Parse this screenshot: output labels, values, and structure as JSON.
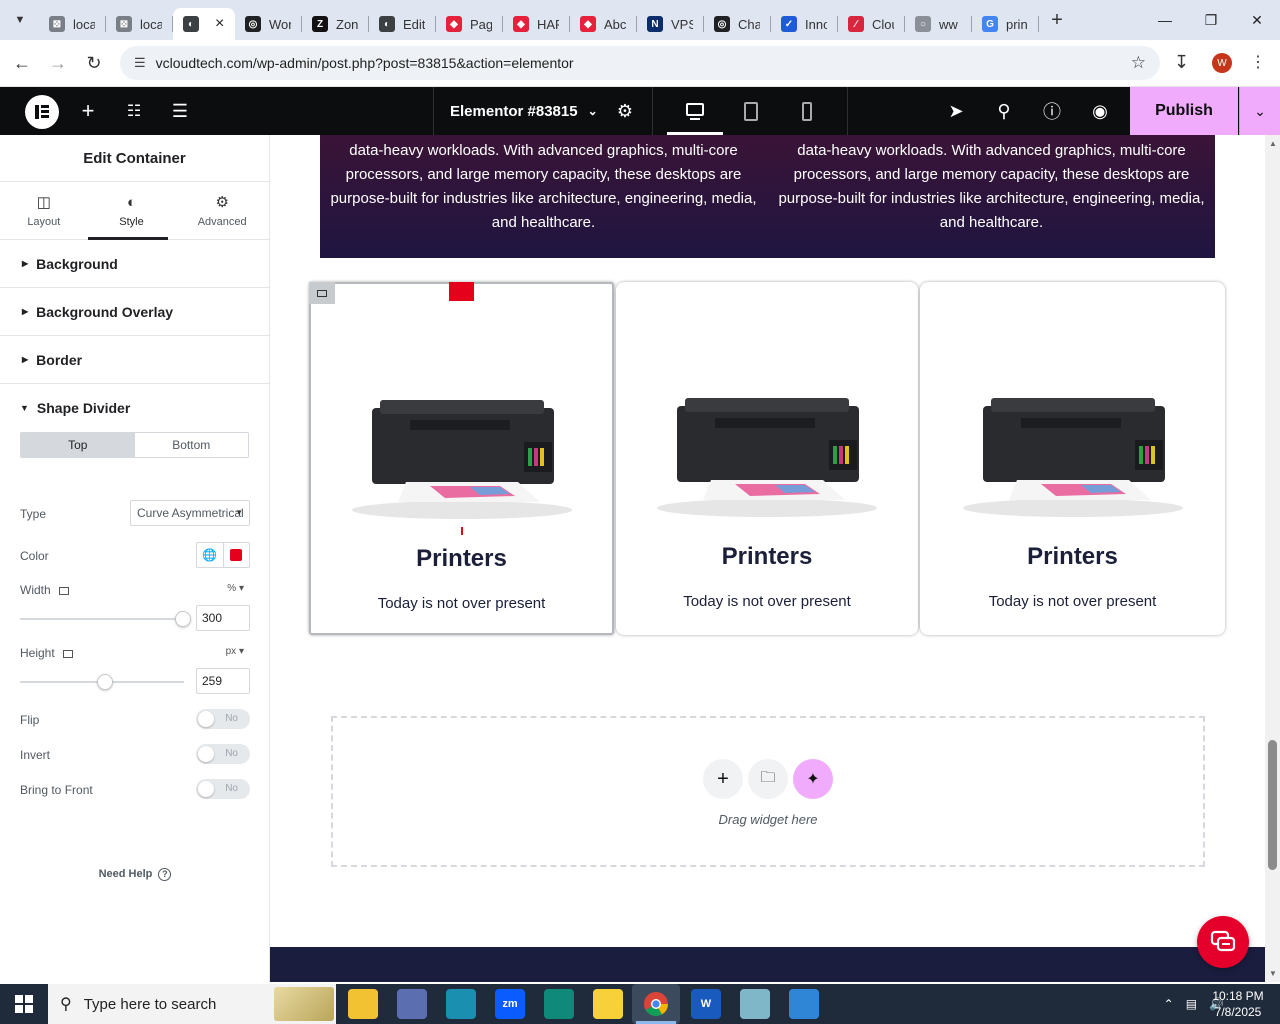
{
  "browser": {
    "tabs": [
      {
        "label": "loca",
        "favicon": "wp-local-icon",
        "color": "#7a7f87",
        "glyph": "⊠"
      },
      {
        "label": "loca",
        "favicon": "wp-local-icon",
        "color": "#7a7f87",
        "glyph": "⊠"
      },
      {
        "label": "",
        "favicon": "wordpress-icon",
        "color": "#3c4043",
        "glyph": "◐",
        "active": true
      },
      {
        "label": "Wor",
        "favicon": "openai-icon",
        "color": "#202124",
        "glyph": "◎"
      },
      {
        "label": "Zon",
        "favicon": "zoro-icon",
        "color": "#111111",
        "glyph": "Z"
      },
      {
        "label": "Edit",
        "favicon": "wordpress-icon",
        "color": "#3c4043",
        "glyph": "◐"
      },
      {
        "label": "Pag",
        "favicon": "elementor-diamond-icon",
        "color": "#e5213c",
        "glyph": "◆"
      },
      {
        "label": "HAF",
        "favicon": "elementor-diamond-icon",
        "color": "#e5213c",
        "glyph": "◆"
      },
      {
        "label": "Abc",
        "favicon": "elementor-diamond-icon",
        "color": "#e5213c",
        "glyph": "◆"
      },
      {
        "label": "VPS",
        "favicon": "vultr-icon",
        "color": "#0c2d6b",
        "glyph": "N"
      },
      {
        "label": "Cha",
        "favicon": "openai-icon",
        "color": "#202124",
        "glyph": "◎"
      },
      {
        "label": "Innc",
        "favicon": "inno-icon",
        "color": "#1f5bd8",
        "glyph": "✓"
      },
      {
        "label": "Clou",
        "favicon": "cloud-icon",
        "color": "#d7263d",
        "glyph": "∕"
      },
      {
        "label": "ww",
        "favicon": "loading-icon",
        "color": "#8a8f98",
        "glyph": "○"
      },
      {
        "label": "prin",
        "favicon": "google-icon",
        "color": "#4285f4",
        "glyph": "G"
      }
    ],
    "new_tab": "+",
    "url": "vcloudtech.com/wp-admin/post.php?post=83815&action=elementor",
    "profile_initial": "W"
  },
  "elementor": {
    "document_title": "Elementor #83815",
    "publish_label": "Publish",
    "accent": "#f0abfc"
  },
  "panel": {
    "title": "Edit Container",
    "tabs": [
      {
        "label": "Layout",
        "icon": "layout-icon"
      },
      {
        "label": "Style",
        "icon": "style-contrast-icon",
        "active": true
      },
      {
        "label": "Advanced",
        "icon": "gear-icon"
      }
    ],
    "sections": [
      "Background",
      "Background Overlay",
      "Border"
    ],
    "shape_divider": {
      "title": "Shape Divider",
      "switch": {
        "top": "Top",
        "bottom": "Bottom",
        "selected": "Top"
      },
      "type_label": "Type",
      "type_value": "Curve Asymmetrical",
      "color_label": "Color",
      "color_value": "#e5001b",
      "width_label": "Width",
      "width_unit": "%",
      "width_value": "300",
      "height_label": "Height",
      "height_unit": "px",
      "height_value": "259",
      "flip_label": "Flip",
      "invert_label": "Invert",
      "front_label": "Bring to Front",
      "toggle_off": "No"
    },
    "need_help": "Need Help"
  },
  "canvas": {
    "band_text": "data-heavy workloads. With advanced graphics, multi-core processors, and large memory capacity, these desktops are purpose-built for industries like architecture, engineering, media, and healthcare.",
    "cards": [
      {
        "title": "Printers",
        "subtitle": "Today is not over present"
      },
      {
        "title": "Printers",
        "subtitle": "Today is not over present"
      },
      {
        "title": "Printers",
        "subtitle": "Today is not over present"
      }
    ],
    "drop_zone_text": "Drag widget here"
  },
  "taskbar": {
    "search_placeholder": "Type here to search",
    "time": "10:18 PM",
    "date": "7/8/2025"
  }
}
